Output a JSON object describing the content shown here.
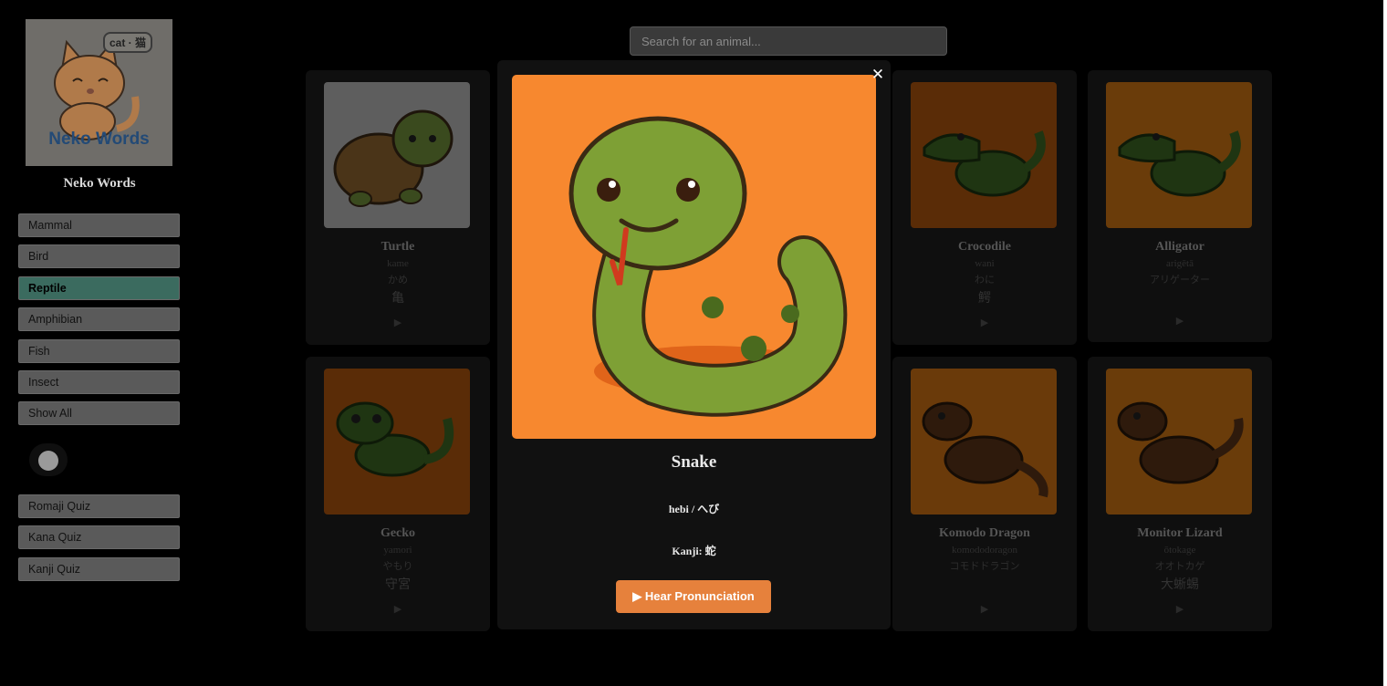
{
  "sidebar": {
    "logo_bubble": "cat · 猫",
    "logo_text": "Neko Words",
    "brand": "Neko Words",
    "categories": [
      "Mammal",
      "Bird",
      "Reptile",
      "Amphibian",
      "Fish",
      "Insect",
      "Show All"
    ],
    "active_category": "Reptile",
    "quizzes": [
      "Romaji Quiz",
      "Kana Quiz",
      "Kanji Quiz"
    ]
  },
  "search": {
    "placeholder": "Search for an animal..."
  },
  "cards": [
    {
      "name": "Turtle",
      "romaji": "kame",
      "kana": "かめ",
      "kanji": "亀",
      "play": "▶"
    },
    {
      "name": "Crocodile",
      "romaji": "wani",
      "kana": "わに",
      "kanji": "鰐",
      "play": "▶"
    },
    {
      "name": "Alligator",
      "romaji": "arigētā",
      "kana": "アリゲーター",
      "kanji": "",
      "play": "▶"
    },
    {
      "name": "Gecko",
      "romaji": "yamori",
      "kana": "やもり",
      "kanji": "守宮",
      "play": "▶"
    },
    {
      "name": "Komodo Dragon",
      "romaji": "komododoragon",
      "kana": "コモドドラゴン",
      "kanji": "",
      "play": "▶"
    },
    {
      "name": "Monitor Lizard",
      "romaji": "ōtokage",
      "kana": "オオトカゲ",
      "kanji": "大蜥蜴",
      "play": "▶"
    }
  ],
  "modal": {
    "close": "✕",
    "title": "Snake",
    "reading": "hebi / へび",
    "kanji": "Kanji: 蛇",
    "button": "▶ Hear Pronunciation"
  },
  "colors": {
    "accent": "#e6813c",
    "active_nav": "#3b6b5f",
    "modal_bg": "#f7882f"
  }
}
